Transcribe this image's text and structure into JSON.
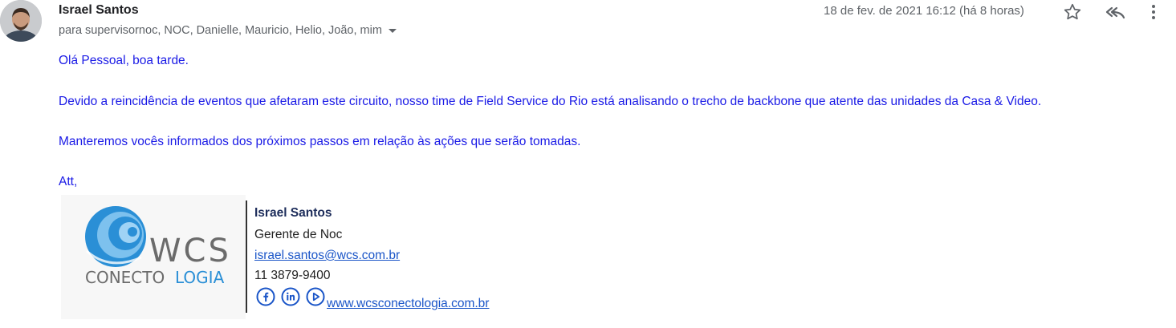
{
  "email": {
    "sender_name": "Israel Santos",
    "recipients_text": "para supervisornoc, NOC, Danielle, Mauricio, Helio, João, mim",
    "date": "18 de fev. de 2021 16:12 (há 8 horas)",
    "body": {
      "greeting": "Olá Pessoal, boa tarde.",
      "paragraph1": "Devido a reincidência de eventos que afetaram este circuito, nosso time de Field Service do Rio está analisando o trecho de backbone que atente das unidades da Casa & Video.",
      "paragraph2": "Manteremos vocês informados dos próximos passos em relação às ações que serão tomadas.",
      "closing": "Att,"
    },
    "signature": {
      "logo_text_1": "WCS",
      "logo_text_2": "CONECTO",
      "logo_text_3": "LOGIA",
      "name": "Israel Santos",
      "role": "Gerente de Noc",
      "email": "israel.santos@wcs.com.br",
      "phone": "11 3879-9400",
      "website": " www.wcsconectologia.com.br",
      "social_icons": [
        "facebook-icon",
        "linkedin-icon",
        "play-icon"
      ]
    }
  },
  "colors": {
    "body_text": "#1a1ae6",
    "link": "#1a55c8",
    "logo_blue": "#2a8fd6",
    "logo_gray": "#6b6b6b"
  }
}
